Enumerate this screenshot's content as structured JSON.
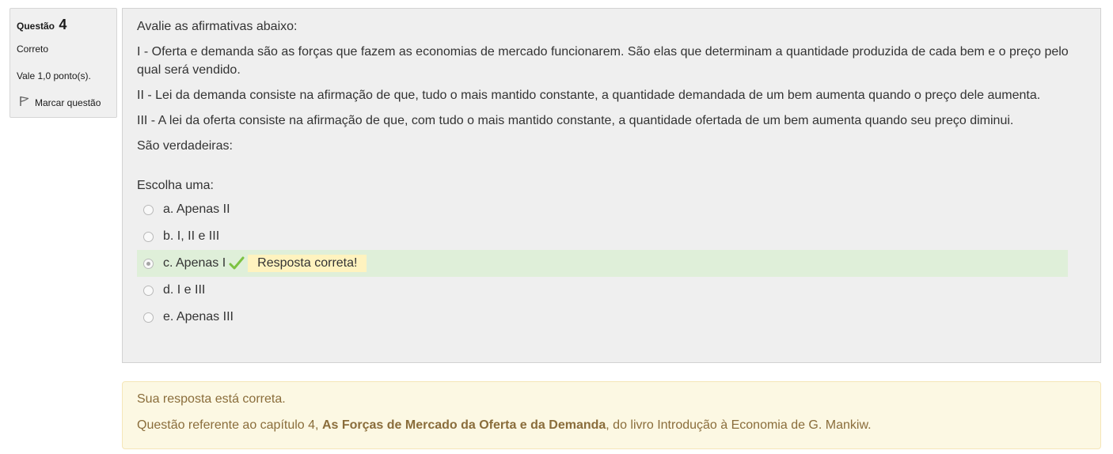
{
  "info": {
    "question_label": "Questão",
    "question_number": "4",
    "state": "Correto",
    "grade": "Vale 1,0 ponto(s).",
    "flag_label": "Marcar questão",
    "flag_icon": "flag-icon"
  },
  "question": {
    "intro": "Avalie as afirmativas abaixo:",
    "statements": [
      "I - Oferta e demanda são as forças que fazem as economias de mercado funcionarem. São elas que determinam a quantidade produzida de cada bem e o preço pelo qual será vendido.",
      "II - Lei da demanda consiste na afirmação de que, tudo o mais mantido constante, a quantidade demandada de um bem aumenta quando o preço dele aumenta.",
      "III - A lei da oferta consiste na afirmação de que, com tudo o mais mantido constante, a quantidade ofertada de um bem aumenta quando seu preço diminui."
    ],
    "closing": "São verdadeiras:",
    "prompt": "Escolha uma:",
    "options": [
      {
        "label": "a. Apenas II",
        "selected": false
      },
      {
        "label": "b. I, II e III",
        "selected": false
      },
      {
        "label": "c. Apenas I",
        "selected": true,
        "feedback": "Resposta correta!",
        "icon": "check-icon"
      },
      {
        "label": "d. I e III",
        "selected": false
      },
      {
        "label": "e. Apenas III",
        "selected": false
      }
    ]
  },
  "outcome": {
    "line1": "Sua resposta está correta.",
    "line2_prefix": "Questão referente ao capítulo 4, ",
    "line2_bold": "As Forças de Mercado da Oferta e da Demanda",
    "line2_suffix": ", do livro Introdução à Economia de G. Mankiw."
  },
  "colors": {
    "correct_row": "#dfefd9",
    "feedback_bg": "#fff3bf",
    "tick": "#7cc242",
    "outcome_text": "#8a6d3b",
    "outcome_bg": "#fcf8e3"
  }
}
